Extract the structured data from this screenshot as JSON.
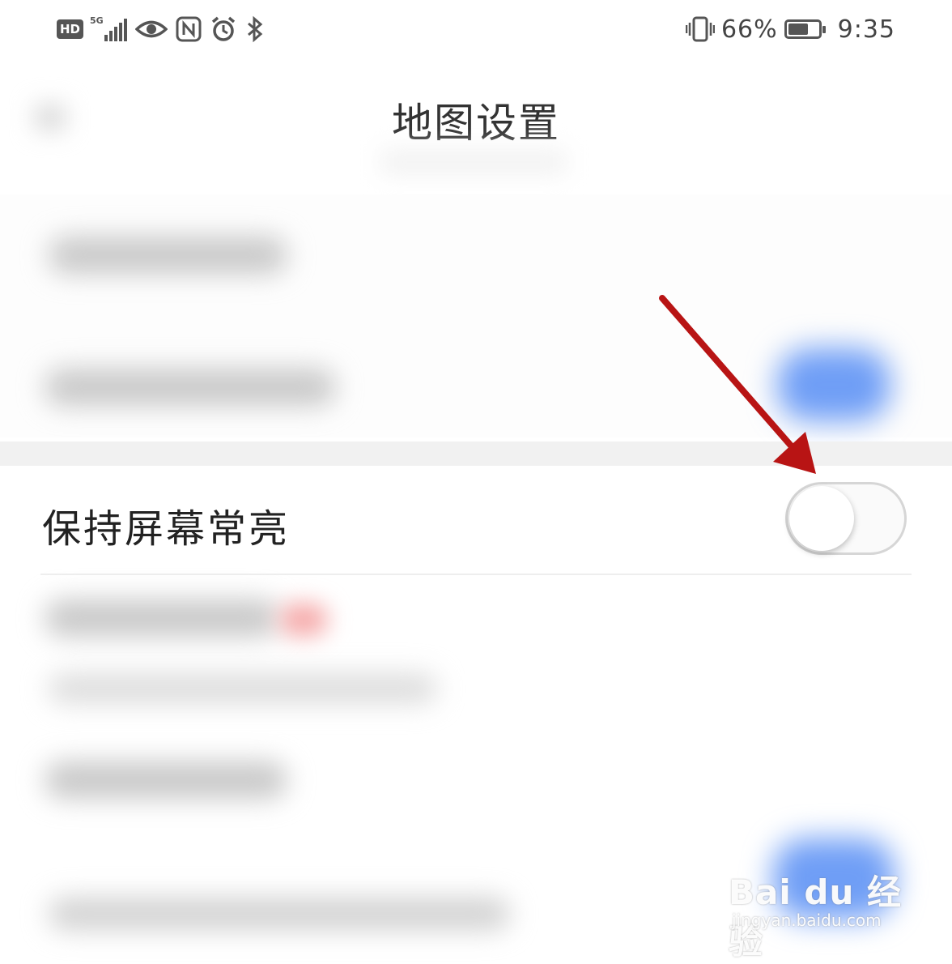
{
  "status_bar": {
    "hd_label": "HD",
    "network_label": "5G",
    "battery_percent_text": "66%",
    "battery_level": 0.66,
    "time": "9:35",
    "icons": [
      "hd-icon",
      "signal-icon",
      "eye-icon",
      "nfc-icon",
      "alarm-icon",
      "bluetooth-icon",
      "vibrate-icon",
      "battery-icon"
    ]
  },
  "header": {
    "title": "地图设置"
  },
  "settings": {
    "keep_screen_on": {
      "label": "保持屏幕常亮",
      "enabled": false
    }
  },
  "annotation": {
    "arrow_color": "#b81414"
  },
  "colors": {
    "accent_blue": "#6f9ef6",
    "background": "#ffffff"
  },
  "watermark": {
    "brand": "Bai du 经验",
    "url": "jingyan.baidu.com"
  }
}
